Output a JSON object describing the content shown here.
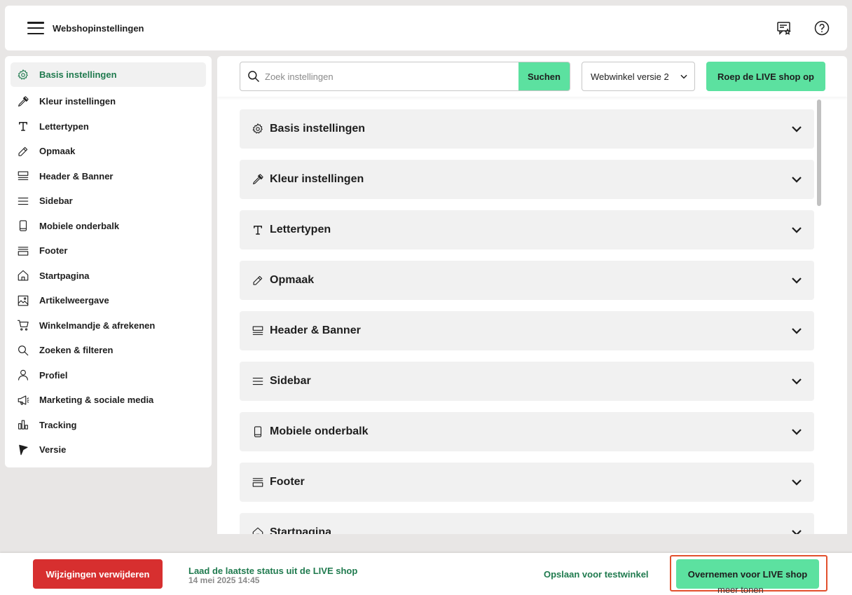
{
  "header": {
    "title": "Webshopinstellingen",
    "icons": [
      "menu-icon",
      "feedback-icon",
      "help-icon"
    ]
  },
  "sidebar": {
    "items": [
      {
        "label": "Basis instellingen",
        "icon": "gear-icon",
        "active": true
      },
      {
        "label": "Kleur instellingen",
        "icon": "eyedropper-icon"
      },
      {
        "label": "Lettertypen",
        "icon": "typography-icon"
      },
      {
        "label": "Opmaak",
        "icon": "pencil-icon"
      },
      {
        "label": "Header & Banner",
        "icon": "header-icon"
      },
      {
        "label": "Sidebar",
        "icon": "lines-icon"
      },
      {
        "label": "Mobiele onderbalk",
        "icon": "phone-icon"
      },
      {
        "label": "Footer",
        "icon": "footer-icon"
      },
      {
        "label": "Startpagina",
        "icon": "home-icon"
      },
      {
        "label": "Artikelweergave",
        "icon": "image-icon"
      },
      {
        "label": "Winkelmandje & afrekenen",
        "icon": "cart-icon"
      },
      {
        "label": "Zoeken & filteren",
        "icon": "search-icon"
      },
      {
        "label": "Profiel",
        "icon": "user-icon"
      },
      {
        "label": "Marketing & sociale media",
        "icon": "megaphone-icon"
      },
      {
        "label": "Tracking",
        "icon": "bar-chart-icon"
      },
      {
        "label": "Versie",
        "icon": "flag-icon"
      }
    ]
  },
  "toolbar": {
    "search_placeholder": "Zoek instellingen",
    "search_button": "Suchen",
    "version_selected": "Webwinkel versie 2",
    "live_button": "Roep de LIVE shop op"
  },
  "sections": [
    {
      "label": "Basis instellingen",
      "icon": "gear-icon"
    },
    {
      "label": "Kleur instellingen",
      "icon": "eyedropper-icon"
    },
    {
      "label": "Lettertypen",
      "icon": "typography-icon"
    },
    {
      "label": "Opmaak",
      "icon": "pencil-icon"
    },
    {
      "label": "Header & Banner",
      "icon": "header-icon"
    },
    {
      "label": "Sidebar",
      "icon": "lines-icon"
    },
    {
      "label": "Mobiele onderbalk",
      "icon": "phone-icon"
    },
    {
      "label": "Footer",
      "icon": "footer-icon"
    },
    {
      "label": "Startpagina",
      "icon": "home-icon"
    }
  ],
  "footer": {
    "discard_button": "Wijzigingen verwijderen",
    "load_live_label": "Laad de laatste status uit de LIVE shop",
    "load_live_date": "14 mei 2025 14:45",
    "save_test": "Opslaan voor testwinkel",
    "adopt_live_button": "Overnemen voor LIVE shop",
    "more_label": "meer tonen"
  },
  "colors": {
    "accent_green": "#5ce1a0",
    "link_green": "#1f7a4e",
    "danger_red": "#d72f2f",
    "highlight_orange": "#e2502d"
  }
}
